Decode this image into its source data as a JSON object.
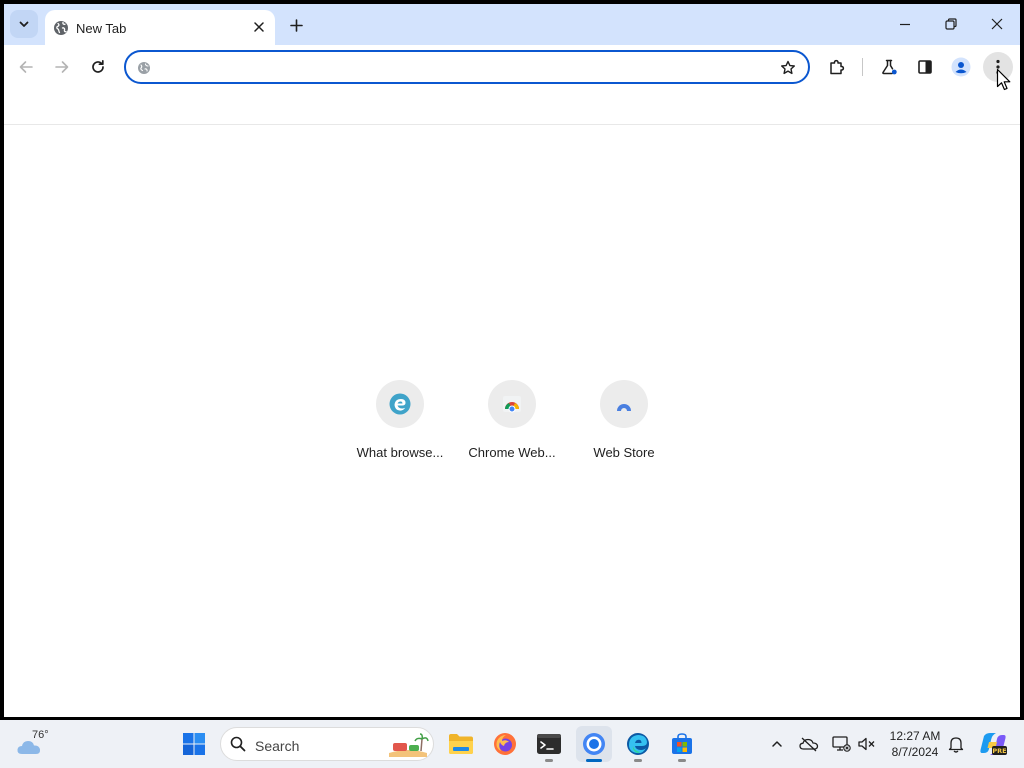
{
  "browser": {
    "tab": {
      "title": "New Tab"
    },
    "omnibox": {
      "value": "",
      "placeholder": ""
    }
  },
  "shortcuts": [
    {
      "label": "What browse...",
      "icon": "edge-logo-icon"
    },
    {
      "label": "Chrome Web...",
      "icon": "chrome-logo-icon"
    },
    {
      "label": "Web Store",
      "icon": "web-store-icon"
    }
  ],
  "taskbar": {
    "weather": {
      "temp": "76°"
    },
    "search": {
      "label": "Search"
    },
    "apps": [
      "file-explorer",
      "firefox",
      "terminal",
      "chrome",
      "edge",
      "microsoft-store"
    ],
    "clock": {
      "time": "12:27 AM",
      "date": "8/7/2024"
    }
  },
  "colors": {
    "tabstrip": "#d3e3fd",
    "accent": "#0b57d0",
    "taskbar": "#eef1f6"
  }
}
